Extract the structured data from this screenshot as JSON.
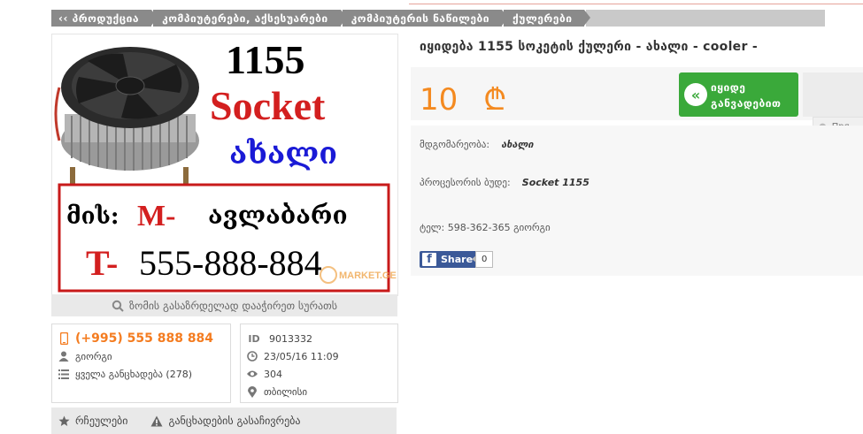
{
  "breadcrumb": {
    "items": [
      "‹‹ პროდუქცია",
      "კომპიუტერები, აქსესუარები",
      "კომპიუტერის ნაწილები",
      "ქულერები"
    ]
  },
  "image": {
    "headline_number": "1155",
    "headline_word": "Socket",
    "headline_georgian": "ახალი",
    "contact_prefix": "მის:",
    "contact_mark": "M-",
    "contact_place": "ავლაბარი",
    "phone_prefix": "T-",
    "phone_number": "555-888-884",
    "watermark": "MARKET.GE",
    "zoom_hint": "ზომის გასაზრდელად დააჭირეთ სურათს"
  },
  "seller": {
    "phone": "(+995) 555 888 884",
    "name": "გიორგი",
    "all_ads": "ყველა განცხადება (278)"
  },
  "meta": {
    "id_label": "ID",
    "id_value": "9013332",
    "date": "23/05/16 11:09",
    "views": "304",
    "city": "თბილისი"
  },
  "actions": {
    "favorites": "რჩეულები",
    "report": "განცხადების გასაჩივრება"
  },
  "listing": {
    "title": "იყიდება 1155 სოკეტის ქულერი - ახალი - cooler -",
    "price": "10",
    "currency_symbol": "₾",
    "buy_button": [
      "იყიდე",
      "განვადებით"
    ],
    "language_pill": "Пря"
  },
  "details": {
    "condition_label": "მდგომარეობა:",
    "condition_value": "ახალი",
    "socket_label": "პროცესორის ბუდე:",
    "socket_value": "Socket 1155",
    "contact_text": "ტელ: 598-362-365 გიორგი"
  },
  "share": {
    "label": "Share",
    "count": "0"
  },
  "colors": {
    "accent_orange": "#f48a20",
    "buy_green": "#3aa93a",
    "facebook_blue": "#3b5998",
    "breadcrumb_grey": "#8a8a8a"
  }
}
